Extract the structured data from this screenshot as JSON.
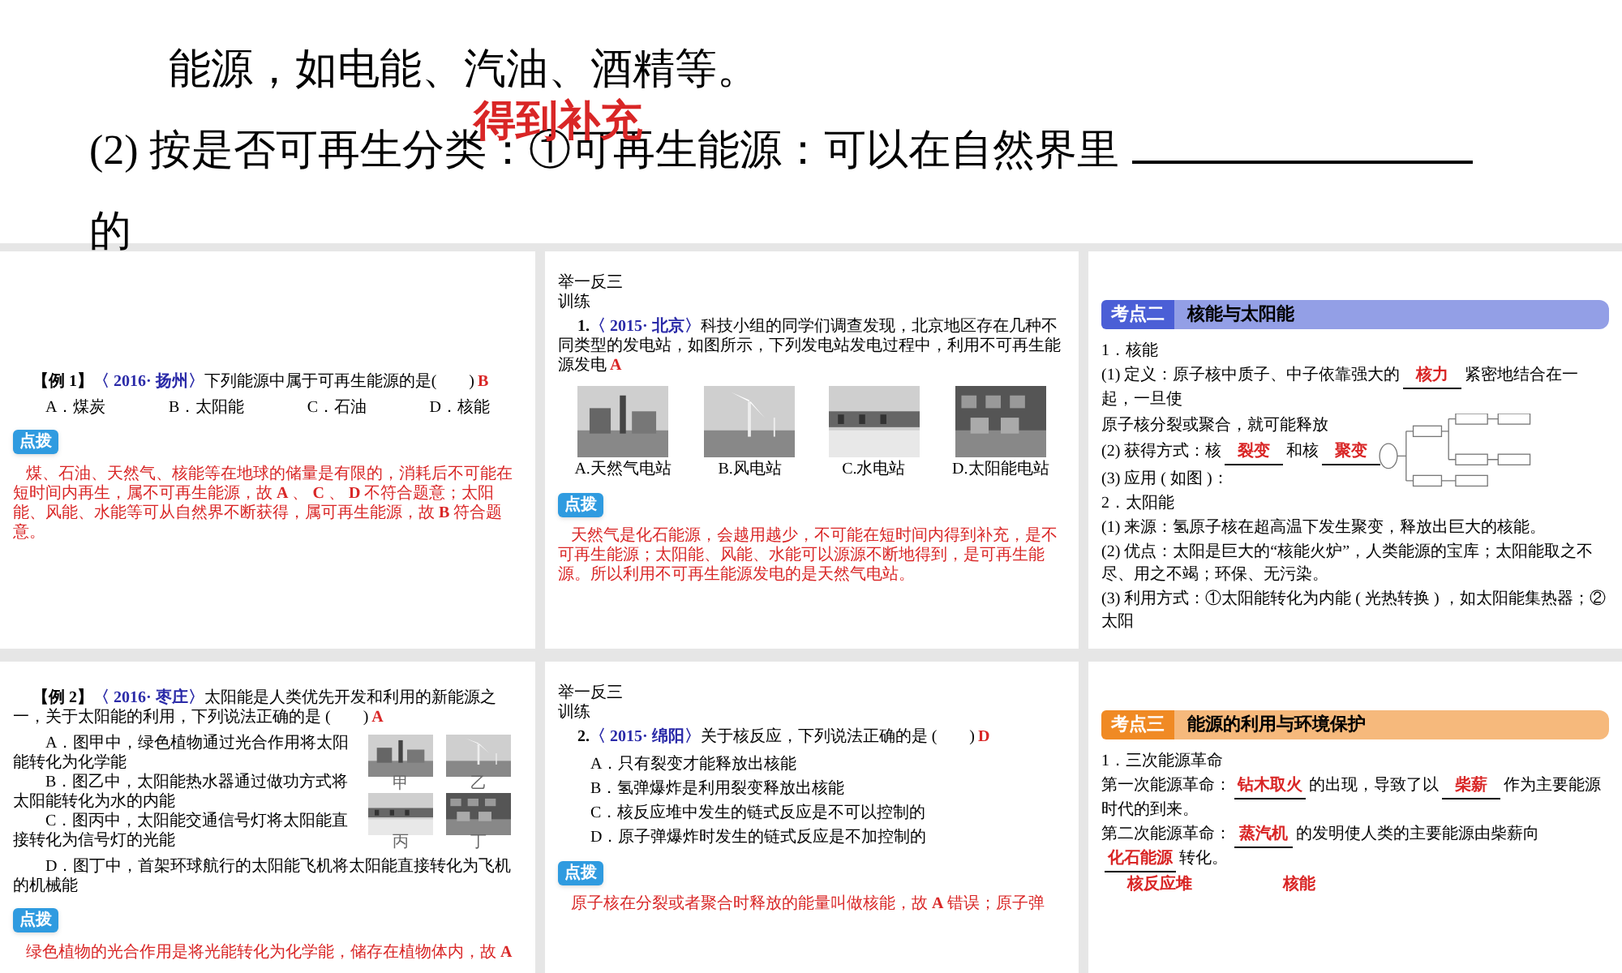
{
  "top_slide": {
    "lines": [
      [
        {
          "kind": "text",
          "text": "能源，如电能、汽油、酒精等。"
        }
      ],
      [
        {
          "kind": "text",
          "text": "(2) 按是否可再生分类：①可再生能源：可以在自然界里"
        },
        {
          "kind": "blank"
        }
      ],
      [
        {
          "kind": "text",
          "text": "的"
        }
      ]
    ],
    "overlay": "得到补充"
  },
  "slides": [
    {
      "kind": "example",
      "blocks": [
        {
          "kind": "question",
          "label": "【例 1】",
          "source": "〈 2016· 扬州〉",
          "text": "下列能源中属于可再生能源的是(　　)",
          "answer": "B"
        },
        {
          "kind": "options_row",
          "options": [
            "A．煤炭",
            "B．太阳能",
            "C．石油",
            "D．核能"
          ]
        },
        {
          "kind": "tag",
          "text": "点拨"
        },
        {
          "kind": "explanation",
          "text": "煤、石油、天然气、核能等在地球的储量是有限的，消耗后不可能在短时间内再生，属不可再生能源，故 **A** 、 **C** 、 **D** 不符合题意；太阳能、风能、水能等可从自然界不断获得，属可再生能源，故 **B** 符合题意。"
        }
      ]
    },
    {
      "kind": "practice",
      "blocks": [
        {
          "kind": "label",
          "text": "举一反三训练"
        },
        {
          "kind": "question",
          "label": "1.",
          "source": "〈 2015· 北京〉",
          "text": "科技小组的同学们调查发现，北京地区存在几种不同类型的发电站，如图所示，下列发电站发电过程中，利用不可再生能源发电",
          "answer": "A"
        },
        {
          "kind": "images",
          "images": [
            {
              "caption": "A.天然气电站"
            },
            {
              "caption": "B.风电站"
            },
            {
              "caption": "C.水电站"
            },
            {
              "caption": "D.太阳能电站"
            }
          ]
        },
        {
          "kind": "tag",
          "text": "点拨"
        },
        {
          "kind": "explanation",
          "text": "天然气是化石能源，会越用越少，不可能在短时间内得到补充，是不可再生能源；太阳能、风能、水能可以源源不断地得到，是可再生能源。所以利用不可再生能源发电的是天然气电站。"
        }
      ]
    },
    {
      "kind": "topic",
      "blocks": [
        {
          "kind": "heading",
          "badge": "考点二",
          "title": "核能与太阳能",
          "color": "#4b5fd6"
        },
        {
          "kind": "line",
          "segments": [
            {
              "kind": "text",
              "text": "1．核能"
            }
          ]
        },
        {
          "kind": "line",
          "segments": [
            {
              "kind": "text",
              "text": "(1) 定义：原子核中质子、中子依靠强大的"
            },
            {
              "kind": "blank",
              "answer": "核力"
            },
            {
              "kind": "text",
              "text": "紧密地结合在一起，一旦使"
            }
          ]
        },
        {
          "kind": "with_diagram",
          "lines": [
            [
              {
                "kind": "text",
                "text": "原子核分裂或聚合，就可能释放"
              }
            ],
            [
              {
                "kind": "text",
                "text": "(2) 获得方式：核"
              },
              {
                "kind": "blank",
                "answer": "裂变"
              },
              {
                "kind": "text",
                "text": "和核"
              },
              {
                "kind": "blank",
                "answer": "聚变"
              }
            ],
            [
              {
                "kind": "text",
                "text": "(3) 应用 ( 如图 )："
              }
            ]
          ]
        },
        {
          "kind": "line",
          "segments": [
            {
              "kind": "text",
              "text": "2．太阳能"
            }
          ]
        },
        {
          "kind": "line",
          "segments": [
            {
              "kind": "text",
              "text": "(1) 来源：氢原子核在超高温下发生聚变，释放出巨大的核能。"
            }
          ]
        },
        {
          "kind": "line",
          "segments": [
            {
              "kind": "text",
              "text": "(2) 优点：太阳是巨大的“核能火炉”，人类能源的宝库；太阳能取之不尽、用之不竭；环保、无污染。"
            }
          ]
        },
        {
          "kind": "line",
          "segments": [
            {
              "kind": "text",
              "text": "(3) 利用方式：①太阳能转化为内能 ( 光热转换 ) ，如太阳能集热器；②太阳"
            }
          ]
        }
      ]
    },
    {
      "kind": "example",
      "blocks": [
        {
          "kind": "question",
          "label": "【例 2】",
          "source": "〈 2016· 枣庄〉",
          "text": "太阳能是人类优先开发和利用的新能源之一，关于太阳能的利用，下列说法正确的是 (　　)",
          "answer": "A"
        },
        {
          "kind": "options_with_images",
          "options": [
            "A．图甲中，绿色植物通过光合作用将太阳能转化为化学能",
            "B．图乙中，太阳能热水器通过做功方式将太阳能转化为水的内能",
            "C．图丙中，太阳能交通信号灯将太阳能直接转化为信号灯的光能"
          ],
          "images": [
            {
              "caption": "甲"
            },
            {
              "caption": "乙"
            },
            {
              "caption": "丙"
            },
            {
              "caption": "丁"
            }
          ]
        },
        {
          "kind": "option",
          "text": "D．图丁中，首架环球航行的太阳能飞机将太阳能直接转化为飞机的机械能"
        },
        {
          "kind": "tag",
          "text": "点拨"
        },
        {
          "kind": "explanation",
          "text": "绿色植物的光合作用是将光能转化为化学能，储存在植物体内，故 **A**"
        }
      ]
    },
    {
      "kind": "practice",
      "blocks": [
        {
          "kind": "label",
          "text": "举一反三训练"
        },
        {
          "kind": "question",
          "label": "2.",
          "source": "〈 2015· 绵阳〉",
          "text": "关于核反应，下列说法正确的是 (　　)",
          "answer": "D"
        },
        {
          "kind": "options_col",
          "options": [
            "A．只有裂变才能释放出核能",
            "B．氢弹爆炸是利用裂变释放出核能",
            "C．核反应堆中发生的链式反应是不可以控制的",
            "D．原子弹爆炸时发生的链式反应是不加控制的"
          ]
        },
        {
          "kind": "tag",
          "text": "点拨"
        },
        {
          "kind": "explanation",
          "text": "原子核在分裂或者聚合时释放的能量叫做核能，故 **A** 错误；原子弹"
        }
      ]
    },
    {
      "kind": "topic",
      "blocks": [
        {
          "kind": "heading",
          "badge": "考点三",
          "title": "能源的利用与环境保护",
          "color": "#f08a24"
        },
        {
          "kind": "line",
          "segments": [
            {
              "kind": "text",
              "text": "1．三次能源革命"
            }
          ]
        },
        {
          "kind": "line",
          "segments": [
            {
              "kind": "text",
              "text": "第一次能源革命："
            },
            {
              "kind": "blank",
              "answer": "钻木取火"
            },
            {
              "kind": "text",
              "text": "的出现，导致了以"
            },
            {
              "kind": "blank",
              "answer": "柴薪"
            },
            {
              "kind": "text",
              "text": "作为主要能源时代的到来。"
            }
          ]
        },
        {
          "kind": "line",
          "segments": [
            {
              "kind": "text",
              "text": "第二次能源革命："
            },
            {
              "kind": "blank",
              "answer": "蒸汽机"
            },
            {
              "kind": "text",
              "text": "的发明使人类的主要能源由柴薪向"
            },
            {
              "kind": "blank",
              "answer": "化石能源"
            },
            {
              "kind": "text",
              "text": "转化。"
            }
          ]
        },
        {
          "kind": "line",
          "segments": [
            {
              "kind": "mark",
              "text": "核反应堆"
            },
            {
              "kind": "mark",
              "text": "核能"
            }
          ]
        }
      ]
    }
  ]
}
